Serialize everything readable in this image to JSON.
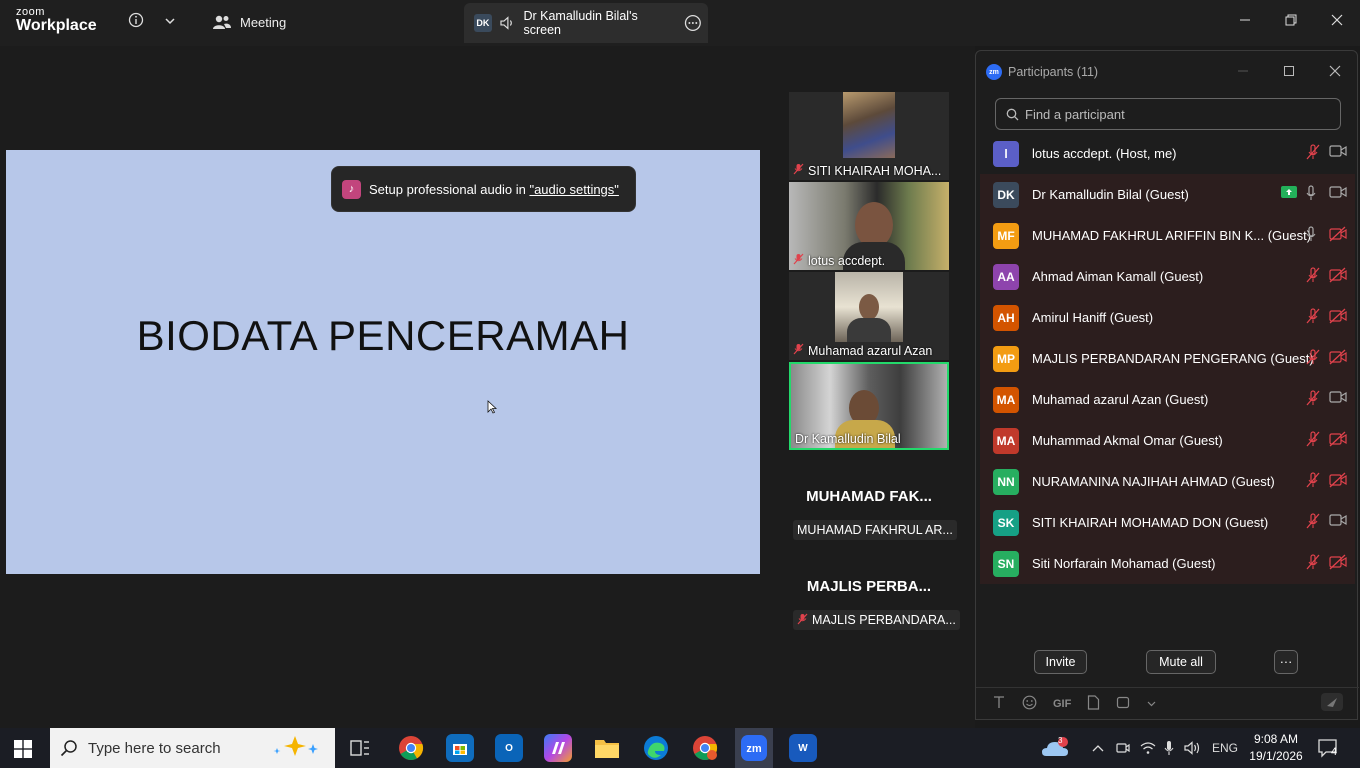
{
  "titlebar": {
    "logo_top": "zoom",
    "logo_bottom": "Workplace",
    "meeting_label": "Meeting",
    "screen_badge": "DK",
    "screen_label": "Dr Kamalludin Bilal's screen"
  },
  "slide": {
    "title": "BIODATA PENCERAMAH",
    "toast_text": "Setup professional audio in ",
    "toast_link": "\"audio settings\""
  },
  "tiles": [
    {
      "name": "SITI KHAIRAH MOHA..."
    },
    {
      "name": "lotus accdept."
    },
    {
      "name": "Muhamad azarul Azan"
    },
    {
      "name": "Dr Kamalludin Bilal"
    }
  ],
  "name_tiles": [
    {
      "big": "MUHAMAD FAK...",
      "chip": "MUHAMAD FAKHRUL AR..."
    },
    {
      "big": "MAJLIS PERBA...",
      "chip": "MAJLIS PERBANDARA..."
    }
  ],
  "panel": {
    "badge": "zm",
    "title": "Participants (11)",
    "search_placeholder": "Find a participant",
    "invite_label": "Invite",
    "mute_all_label": "Mute all",
    "more_label": "···",
    "gif_label": "GIF"
  },
  "participants": [
    {
      "initials": "l",
      "name": "lotus accdept. (Host, me)",
      "color": "#5b5fc7",
      "mic": "muted",
      "video": "on",
      "share": false
    },
    {
      "initials": "DK",
      "name": "Dr Kamalludin Bilal (Guest)",
      "color": "#3b4a5c",
      "mic": "on",
      "video": "on",
      "share": true
    },
    {
      "initials": "MF",
      "name": "MUHAMAD FAKHRUL ARIFFIN BIN K... (Guest)",
      "color": "#f39c12",
      "mic": "on",
      "video": "off",
      "share": false
    },
    {
      "initials": "AA",
      "name": "Ahmad Aiman Kamall (Guest)",
      "color": "#8e44ad",
      "mic": "muted",
      "video": "off",
      "share": false
    },
    {
      "initials": "AH",
      "name": "Amirul Haniff (Guest)",
      "color": "#d35400",
      "mic": "muted",
      "video": "off",
      "share": false
    },
    {
      "initials": "MP",
      "name": "MAJLIS PERBANDARAN PENGERANG (Guest)",
      "color": "#f39c12",
      "mic": "muted",
      "video": "off",
      "share": false
    },
    {
      "initials": "MA",
      "name": "Muhamad azarul Azan (Guest)",
      "color": "#d35400",
      "mic": "muted",
      "video": "on",
      "share": false
    },
    {
      "initials": "MA",
      "name": "Muhammad Akmal Omar (Guest)",
      "color": "#c0392b",
      "mic": "muted",
      "video": "off",
      "share": false
    },
    {
      "initials": "NN",
      "name": "NURAMANINA NAJIHAH AHMAD (Guest)",
      "color": "#27ae60",
      "mic": "muted",
      "video": "off",
      "share": false
    },
    {
      "initials": "SK",
      "name": "SITI KHAIRAH MOHAMAD DON (Guest)",
      "color": "#16a085",
      "mic": "muted",
      "video": "on",
      "share": false
    },
    {
      "initials": "SN",
      "name": "Siti Norfarain Mohamad (Guest)",
      "color": "#27ae60",
      "mic": "muted",
      "video": "off",
      "share": false
    }
  ],
  "taskbar": {
    "search_placeholder": "Type here to search",
    "weather_badge": "3",
    "language": "ENG",
    "time": "9:08 AM",
    "date": "19/1/2026",
    "notification_count": "4"
  }
}
